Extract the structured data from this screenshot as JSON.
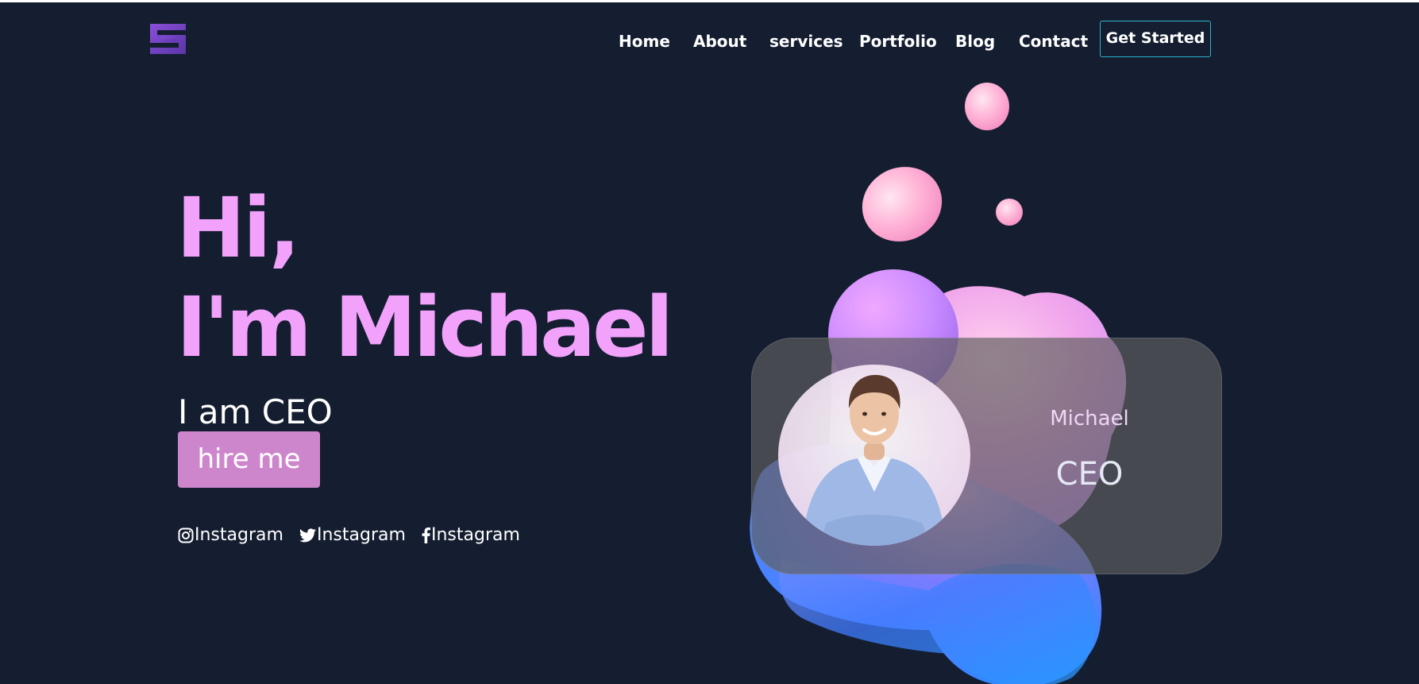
{
  "colors": {
    "page_bg": "#141e30",
    "accent_pink": "#f3a2fb",
    "button_bg": "#cd86cc",
    "cta_border": "#2fb4c8",
    "logo": "#6b3fb8"
  },
  "header": {
    "logo_icon": "stacked-e-logo-icon",
    "nav": [
      {
        "label": "Home"
      },
      {
        "label": "About"
      },
      {
        "label": "services"
      },
      {
        "label": "Portfolio"
      },
      {
        "label": "Blog"
      },
      {
        "label": "Contact"
      }
    ],
    "cta_label": "Get Started"
  },
  "hero": {
    "greeting": "Hi,",
    "name_line": "I'm Michael",
    "role_line": "I am CEO",
    "hire_label": "hire me",
    "socials": [
      {
        "icon": "instagram-icon",
        "label": "Instagram"
      },
      {
        "icon": "twitter-icon",
        "label": "Instagram"
      },
      {
        "icon": "facebook-icon",
        "label": "Instagram"
      }
    ]
  },
  "profile_card": {
    "avatar_icon": "person-photo-icon",
    "name": "Michael",
    "role": "CEO"
  }
}
